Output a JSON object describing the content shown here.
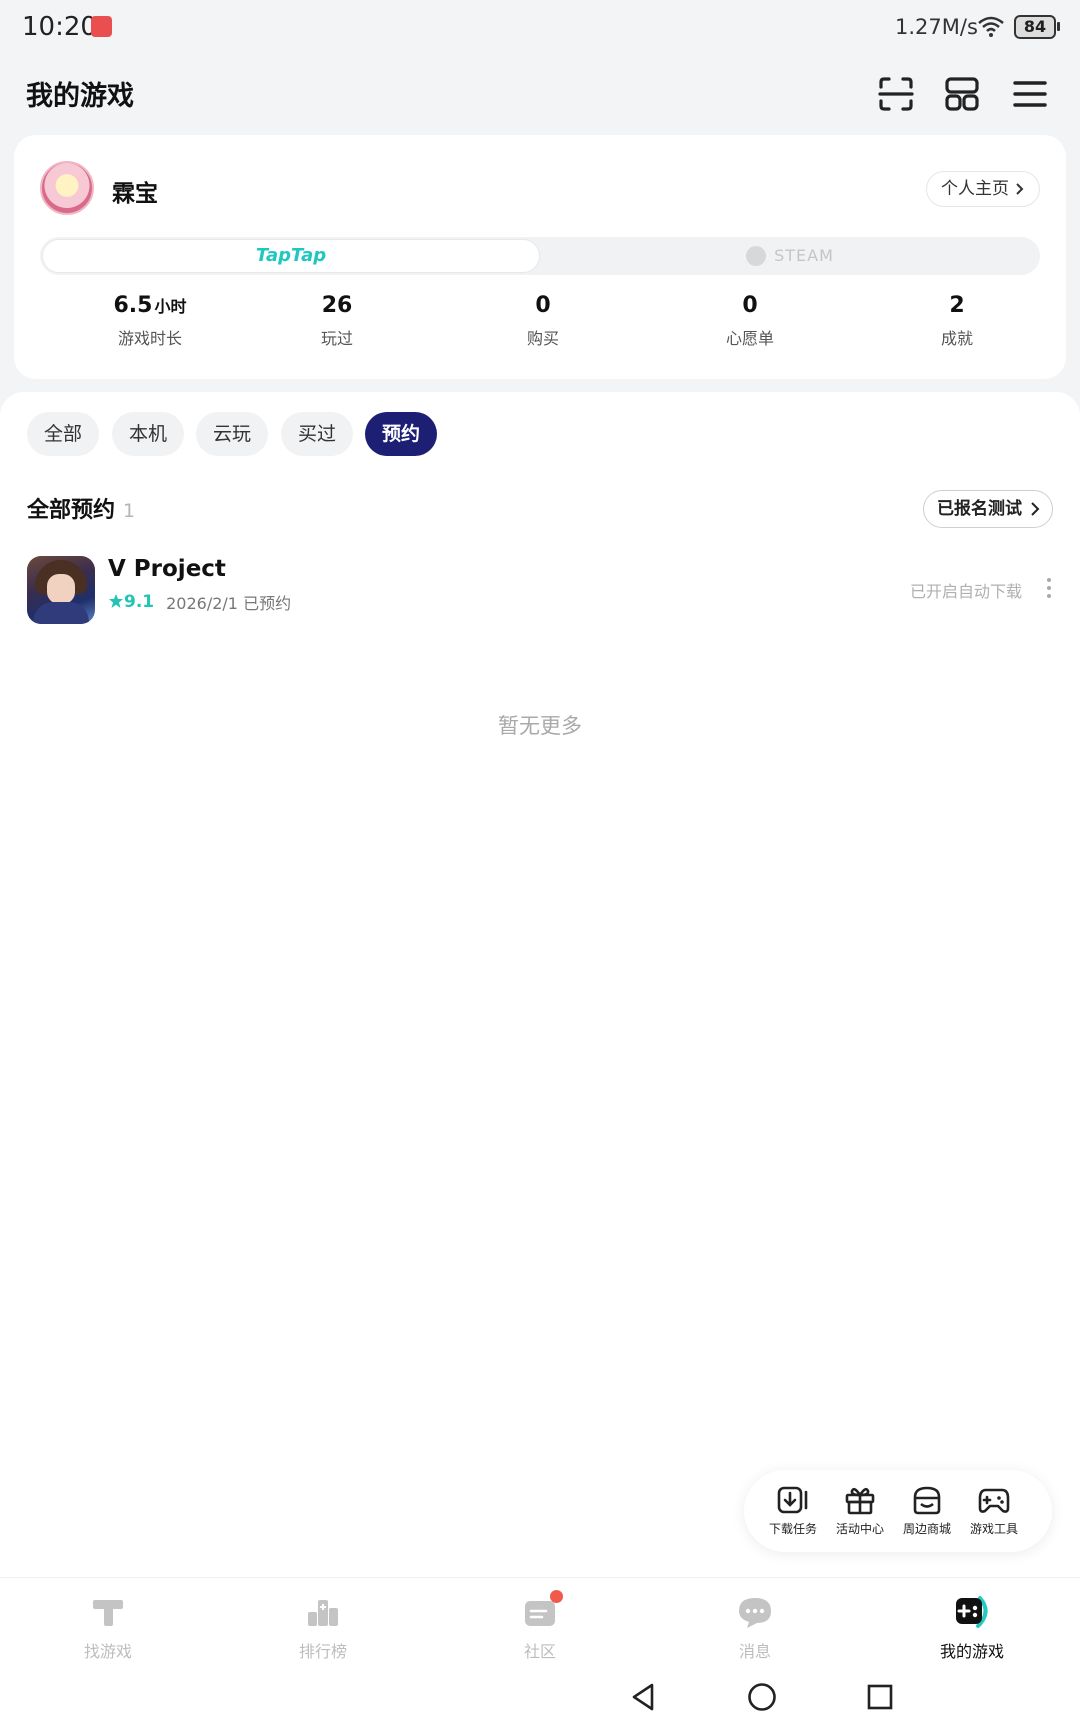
{
  "status_bar": {
    "time": "10:20",
    "speed": "1.27M/s",
    "battery": "84"
  },
  "header": {
    "title": "我的游戏"
  },
  "profile": {
    "name": "霖宝",
    "homepage_label": "个人主页",
    "platforms": {
      "taptap": "TapTap",
      "steam": "STEAM"
    },
    "stats": [
      {
        "value": "6.5",
        "unit": "小时",
        "label": "游戏时长"
      },
      {
        "value": "26",
        "label": "玩过"
      },
      {
        "value": "0",
        "label": "购买"
      },
      {
        "value": "0",
        "label": "心愿单"
      },
      {
        "value": "2",
        "label": "成就"
      }
    ]
  },
  "filters": {
    "items": [
      "全部",
      "本机",
      "云玩",
      "买过",
      "预约"
    ],
    "active": "预约"
  },
  "section": {
    "title": "全部预约",
    "count": "1",
    "signed_label": "已报名测试"
  },
  "games": [
    {
      "name": "V Project",
      "rating": "9.1",
      "date": "2026/2/1 已预约",
      "status": "已开启自动下载"
    }
  ],
  "empty_text": "暂无更多",
  "toolbar": {
    "items": [
      "下载任务",
      "活动中心",
      "周边商城",
      "游戏工具"
    ]
  },
  "bottom_nav": {
    "items": [
      "找游戏",
      "排行榜",
      "社区",
      "消息",
      "我的游戏"
    ],
    "active": "我的游戏"
  },
  "colors": {
    "accent": "#1d1f74",
    "taptap": "#1fc7c1",
    "rating": "#23c4b6",
    "badge": "#ef5a4a"
  }
}
